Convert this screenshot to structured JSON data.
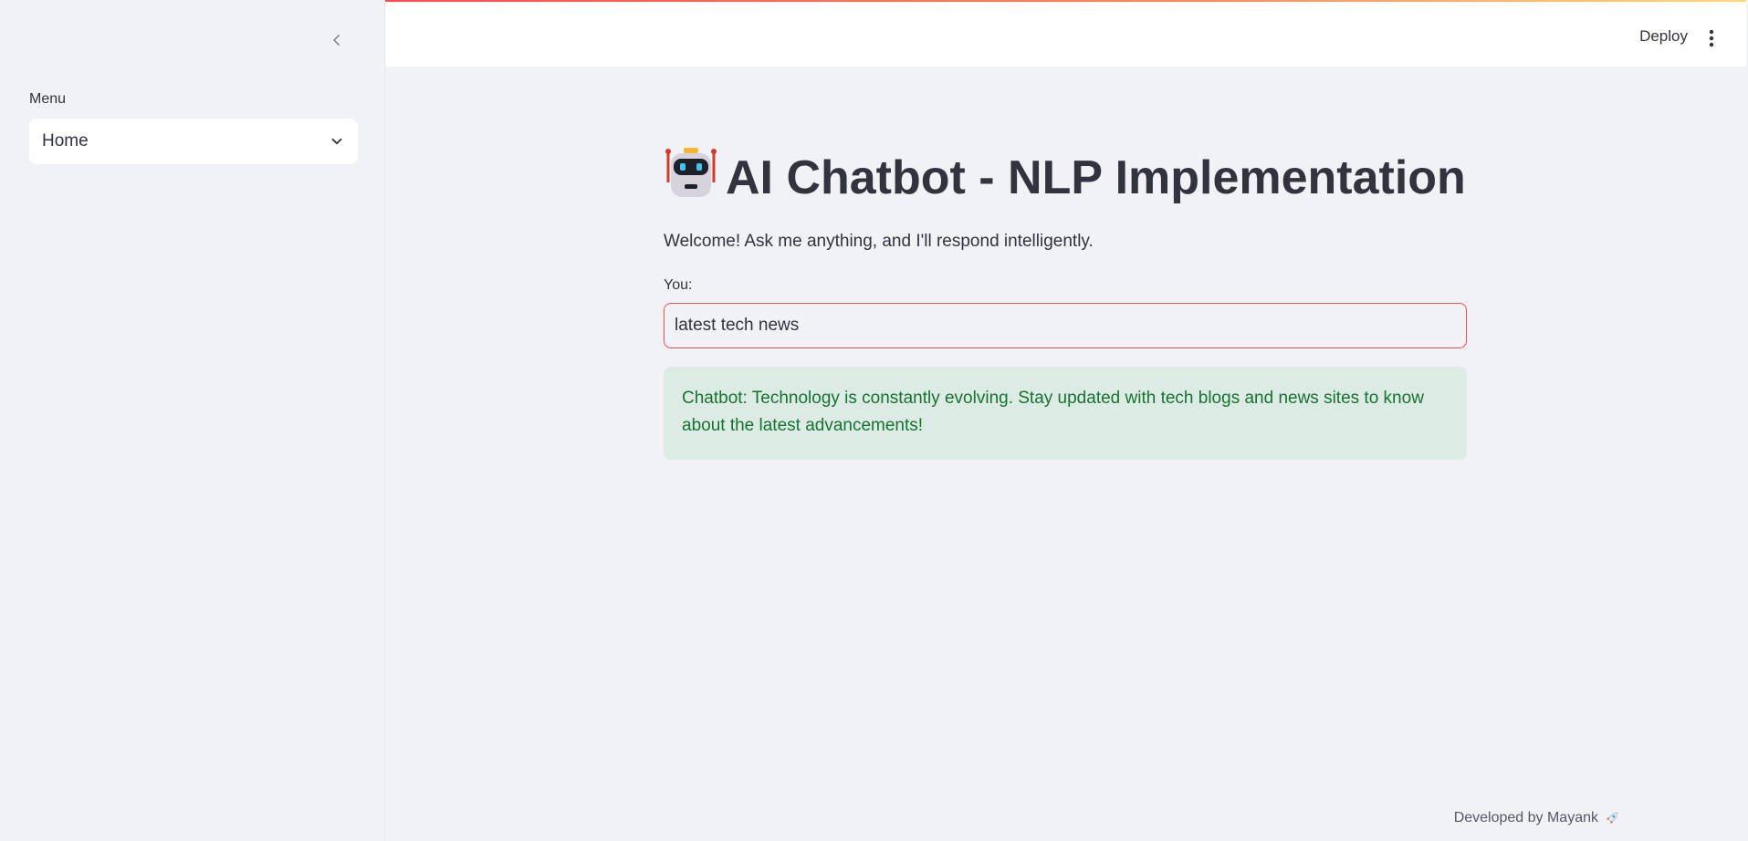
{
  "sidebar": {
    "menu_label": "Menu",
    "menu_selected": "Home"
  },
  "header": {
    "deploy_label": "Deploy"
  },
  "main": {
    "title": "AI Chatbot - NLP Implementation",
    "welcome": "Welcome! Ask me anything, and I'll respond intelligently.",
    "input_label": "You:",
    "input_value": "latest tech news",
    "response": "Chatbot: Technology is constantly evolving. Stay updated with tech blogs and news sites to know about the latest advancements!"
  },
  "footer": {
    "text": "Developed by Mayank"
  },
  "icons": {
    "collapse": "chevron-left-icon",
    "dropdown": "chevron-down-icon",
    "menu": "kebab-menu-icon",
    "title": "robot-icon",
    "footer": "rocket-icon"
  },
  "colors": {
    "accent": "#ff4b4b",
    "background": "#f0f2f6",
    "success_bg": "#dcebe4",
    "success_text": "#177233"
  }
}
